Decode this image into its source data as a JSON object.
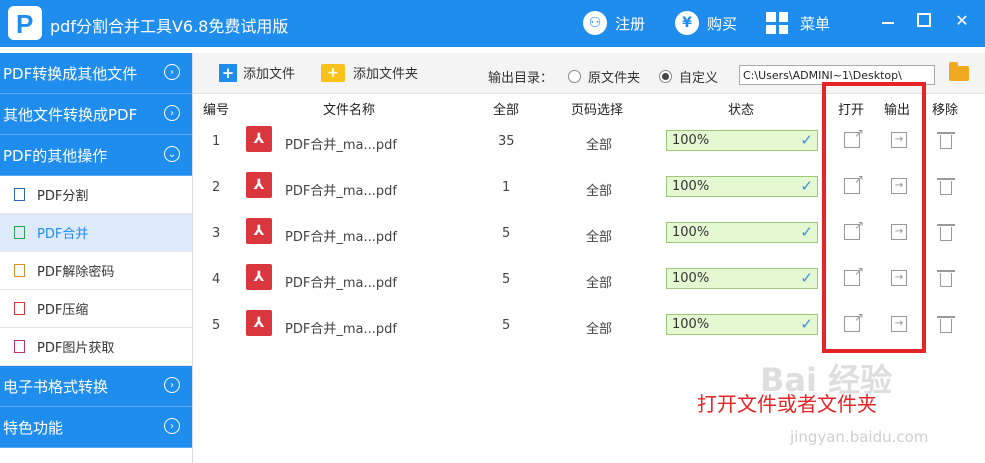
{
  "app": {
    "title": "pdf分割合并工具V6.8免费试用版",
    "logo_letter": "P",
    "register_label": "注册",
    "buy_label": "购买",
    "menu_label": "菜单",
    "close_glyph": "✕"
  },
  "sidebar": {
    "categories": [
      {
        "label": "PDF转换成其他文件",
        "chevron": "›"
      },
      {
        "label": "其他文件转换成PDF",
        "chevron": "›"
      },
      {
        "label": "PDF的其他操作",
        "chevron": "⌄"
      }
    ],
    "items": [
      {
        "label": "PDF分割",
        "icon_color": "#2c64b6"
      },
      {
        "label": "PDF合并",
        "icon_color": "#2f9e57",
        "active": true
      },
      {
        "label": "PDF解除密码",
        "icon_color": "#d4912b"
      },
      {
        "label": "PDF压缩",
        "icon_color": "#d9363e"
      },
      {
        "label": "PDF图片获取",
        "icon_color": "#b8346a"
      }
    ],
    "bottom_categories": [
      {
        "label": "电子书格式转换",
        "chevron": "›"
      },
      {
        "label": "特色功能",
        "chevron": "›"
      }
    ]
  },
  "toolbar": {
    "add_file_label": "添加文件",
    "add_folder_label": "添加文件夹",
    "output_dir_label": "输出目录：",
    "radio_original": "原文件夹",
    "radio_custom": "自定义",
    "output_path": "C:\\Users\\ADMINI~1\\Desktop\\"
  },
  "table": {
    "headers": {
      "index": "编号",
      "name": "文件名称",
      "total": "全部",
      "page_select": "页码选择",
      "status": "状态",
      "open": "打开",
      "output": "输出",
      "remove": "移除"
    },
    "rows": [
      {
        "index": "1",
        "name": "PDF合并_ma...pdf",
        "total": "35",
        "page_select": "全部",
        "status": "100%",
        "progress": 100
      },
      {
        "index": "2",
        "name": "PDF合并_ma...pdf",
        "total": "1",
        "page_select": "全部",
        "status": "100%",
        "progress": 100
      },
      {
        "index": "3",
        "name": "PDF合并_ma...pdf",
        "total": "5",
        "page_select": "全部",
        "status": "100%",
        "progress": 100
      },
      {
        "index": "4",
        "name": "PDF合并_ma...pdf",
        "total": "5",
        "page_select": "全部",
        "status": "100%",
        "progress": 100
      },
      {
        "index": "5",
        "name": "PDF合并_ma...pdf",
        "total": "5",
        "page_select": "全部",
        "status": "100%",
        "progress": 100
      }
    ]
  },
  "annotation": {
    "text": "打开文件或者文件夹"
  },
  "watermark": {
    "text": "Bai 经验",
    "url": "jingyan.baidu.com"
  },
  "colors": {
    "brand": "#1f8ded",
    "highlight": "#e52525"
  }
}
